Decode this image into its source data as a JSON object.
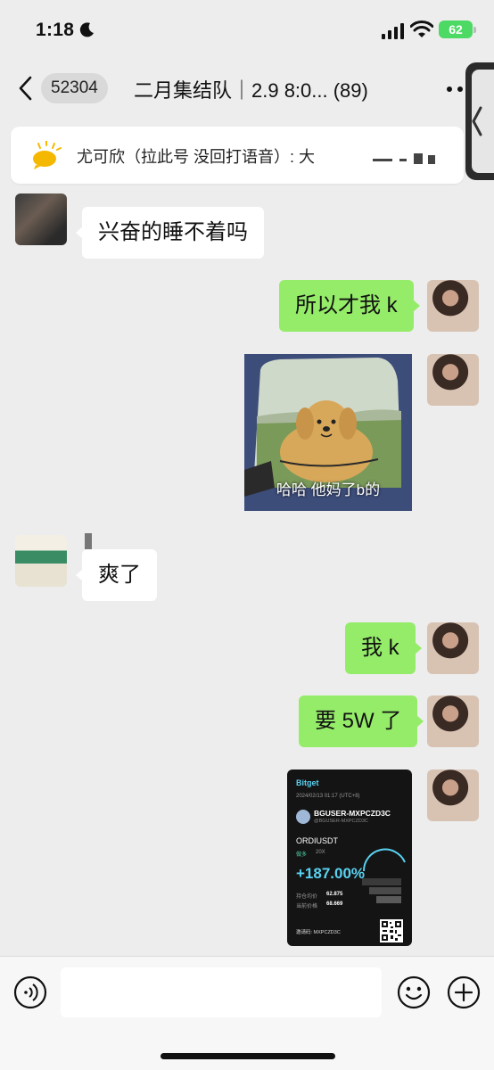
{
  "status_bar": {
    "time": "1:18",
    "battery": "62"
  },
  "nav": {
    "unread_count": "52304",
    "title": "二月集结队｜2.9 8:0... (89)"
  },
  "notice": {
    "text": "尤可欣（拉此号 没回打语音）: 大"
  },
  "messages": [
    {
      "side": "left",
      "text": "兴奋的睡不着吗"
    },
    {
      "side": "right",
      "text": "所以才我 k"
    },
    {
      "side": "right",
      "type": "sticker",
      "caption": "哈哈 他妈了b的"
    },
    {
      "side": "left",
      "text": "爽了"
    },
    {
      "side": "right",
      "text": "我 k"
    },
    {
      "side": "right",
      "text": "要 5W 了"
    },
    {
      "side": "right",
      "type": "image",
      "card": {
        "logo": "Bitget",
        "timestamp": "2024/02/13 01:17 (UTC+8)",
        "username": "BGUSER-MXPCZD3C",
        "handle": "@BGUSER-MXPCZD3C",
        "pair": "ORDIUSDT",
        "side": "做多",
        "leverage": "20X",
        "pnl": "+187.00%",
        "avg_price_label": "持仓均价",
        "avg_price": "62.875",
        "mark_price_label": "当前价格",
        "mark_price": "68.669",
        "invite_code": "邀请码: MXPCZD3C"
      }
    }
  ],
  "input": {
    "placeholder": ""
  },
  "colors": {
    "accent": "#95ec69",
    "background": "#ededed",
    "bitget_cyan": "#59d2f2"
  }
}
